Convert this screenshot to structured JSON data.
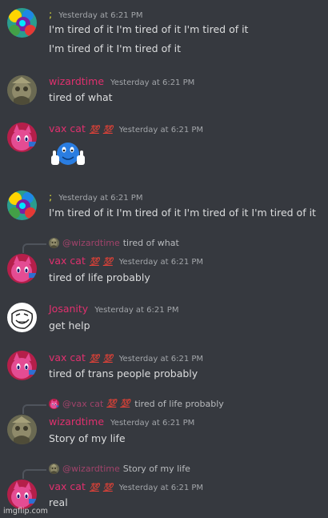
{
  "colors": {
    "background": "#36393f",
    "name_semicolon": "#e4e43a",
    "name_wizardtime": "#e0306e",
    "name_vaxcat": "#e0306e",
    "name_josanity": "#e0306e"
  },
  "messages": [
    {
      "author": ";",
      "timestamp": "Yesterday at 6:21 PM",
      "lines": [
        "I'm tired of it I'm tired of it I'm tired of it",
        "I'm tired of it I'm tired of it"
      ]
    },
    {
      "author": "wizardtime",
      "timestamp": "Yesterday at 6:21 PM",
      "lines": [
        "tired of what"
      ]
    },
    {
      "author": "vax cat",
      "badges": [
        "💯",
        "💯"
      ],
      "timestamp": "Yesterday at 6:21 PM",
      "attachment": "thumbs-up-blob-emoji"
    },
    {
      "author": ";",
      "timestamp": "Yesterday at 6:21 PM",
      "lines": [
        "I'm tired of it I'm tired of it I'm tired of it I'm tired of it"
      ]
    },
    {
      "reply": {
        "name": "@wizardtime",
        "text": "tired of what"
      },
      "author": "vax cat",
      "badges": [
        "💯",
        "💯"
      ],
      "timestamp": "Yesterday at 6:21 PM",
      "lines": [
        "tired of life probably"
      ]
    },
    {
      "author": "Josanity",
      "timestamp": "Yesterday at 6:21 PM",
      "lines": [
        "get help"
      ]
    },
    {
      "author": "vax cat",
      "badges": [
        "💯",
        "💯"
      ],
      "timestamp": "Yesterday at 6:21 PM",
      "lines": [
        "tired of trans people probably"
      ]
    },
    {
      "reply": {
        "name": "@vax cat",
        "badges": [
          "💯",
          "💯"
        ],
        "text": "tired of life probably"
      },
      "author": "wizardtime",
      "timestamp": "Yesterday at 6:21 PM",
      "lines": [
        "Story of my life"
      ]
    },
    {
      "reply": {
        "name": "@wizardtime",
        "text": "Story of my life"
      },
      "author": "vax cat",
      "badges": [
        "💯",
        "💯"
      ],
      "timestamp": "Yesterday at 6:21 PM",
      "lines": [
        "real"
      ]
    }
  ],
  "watermark": "imgflip.com"
}
